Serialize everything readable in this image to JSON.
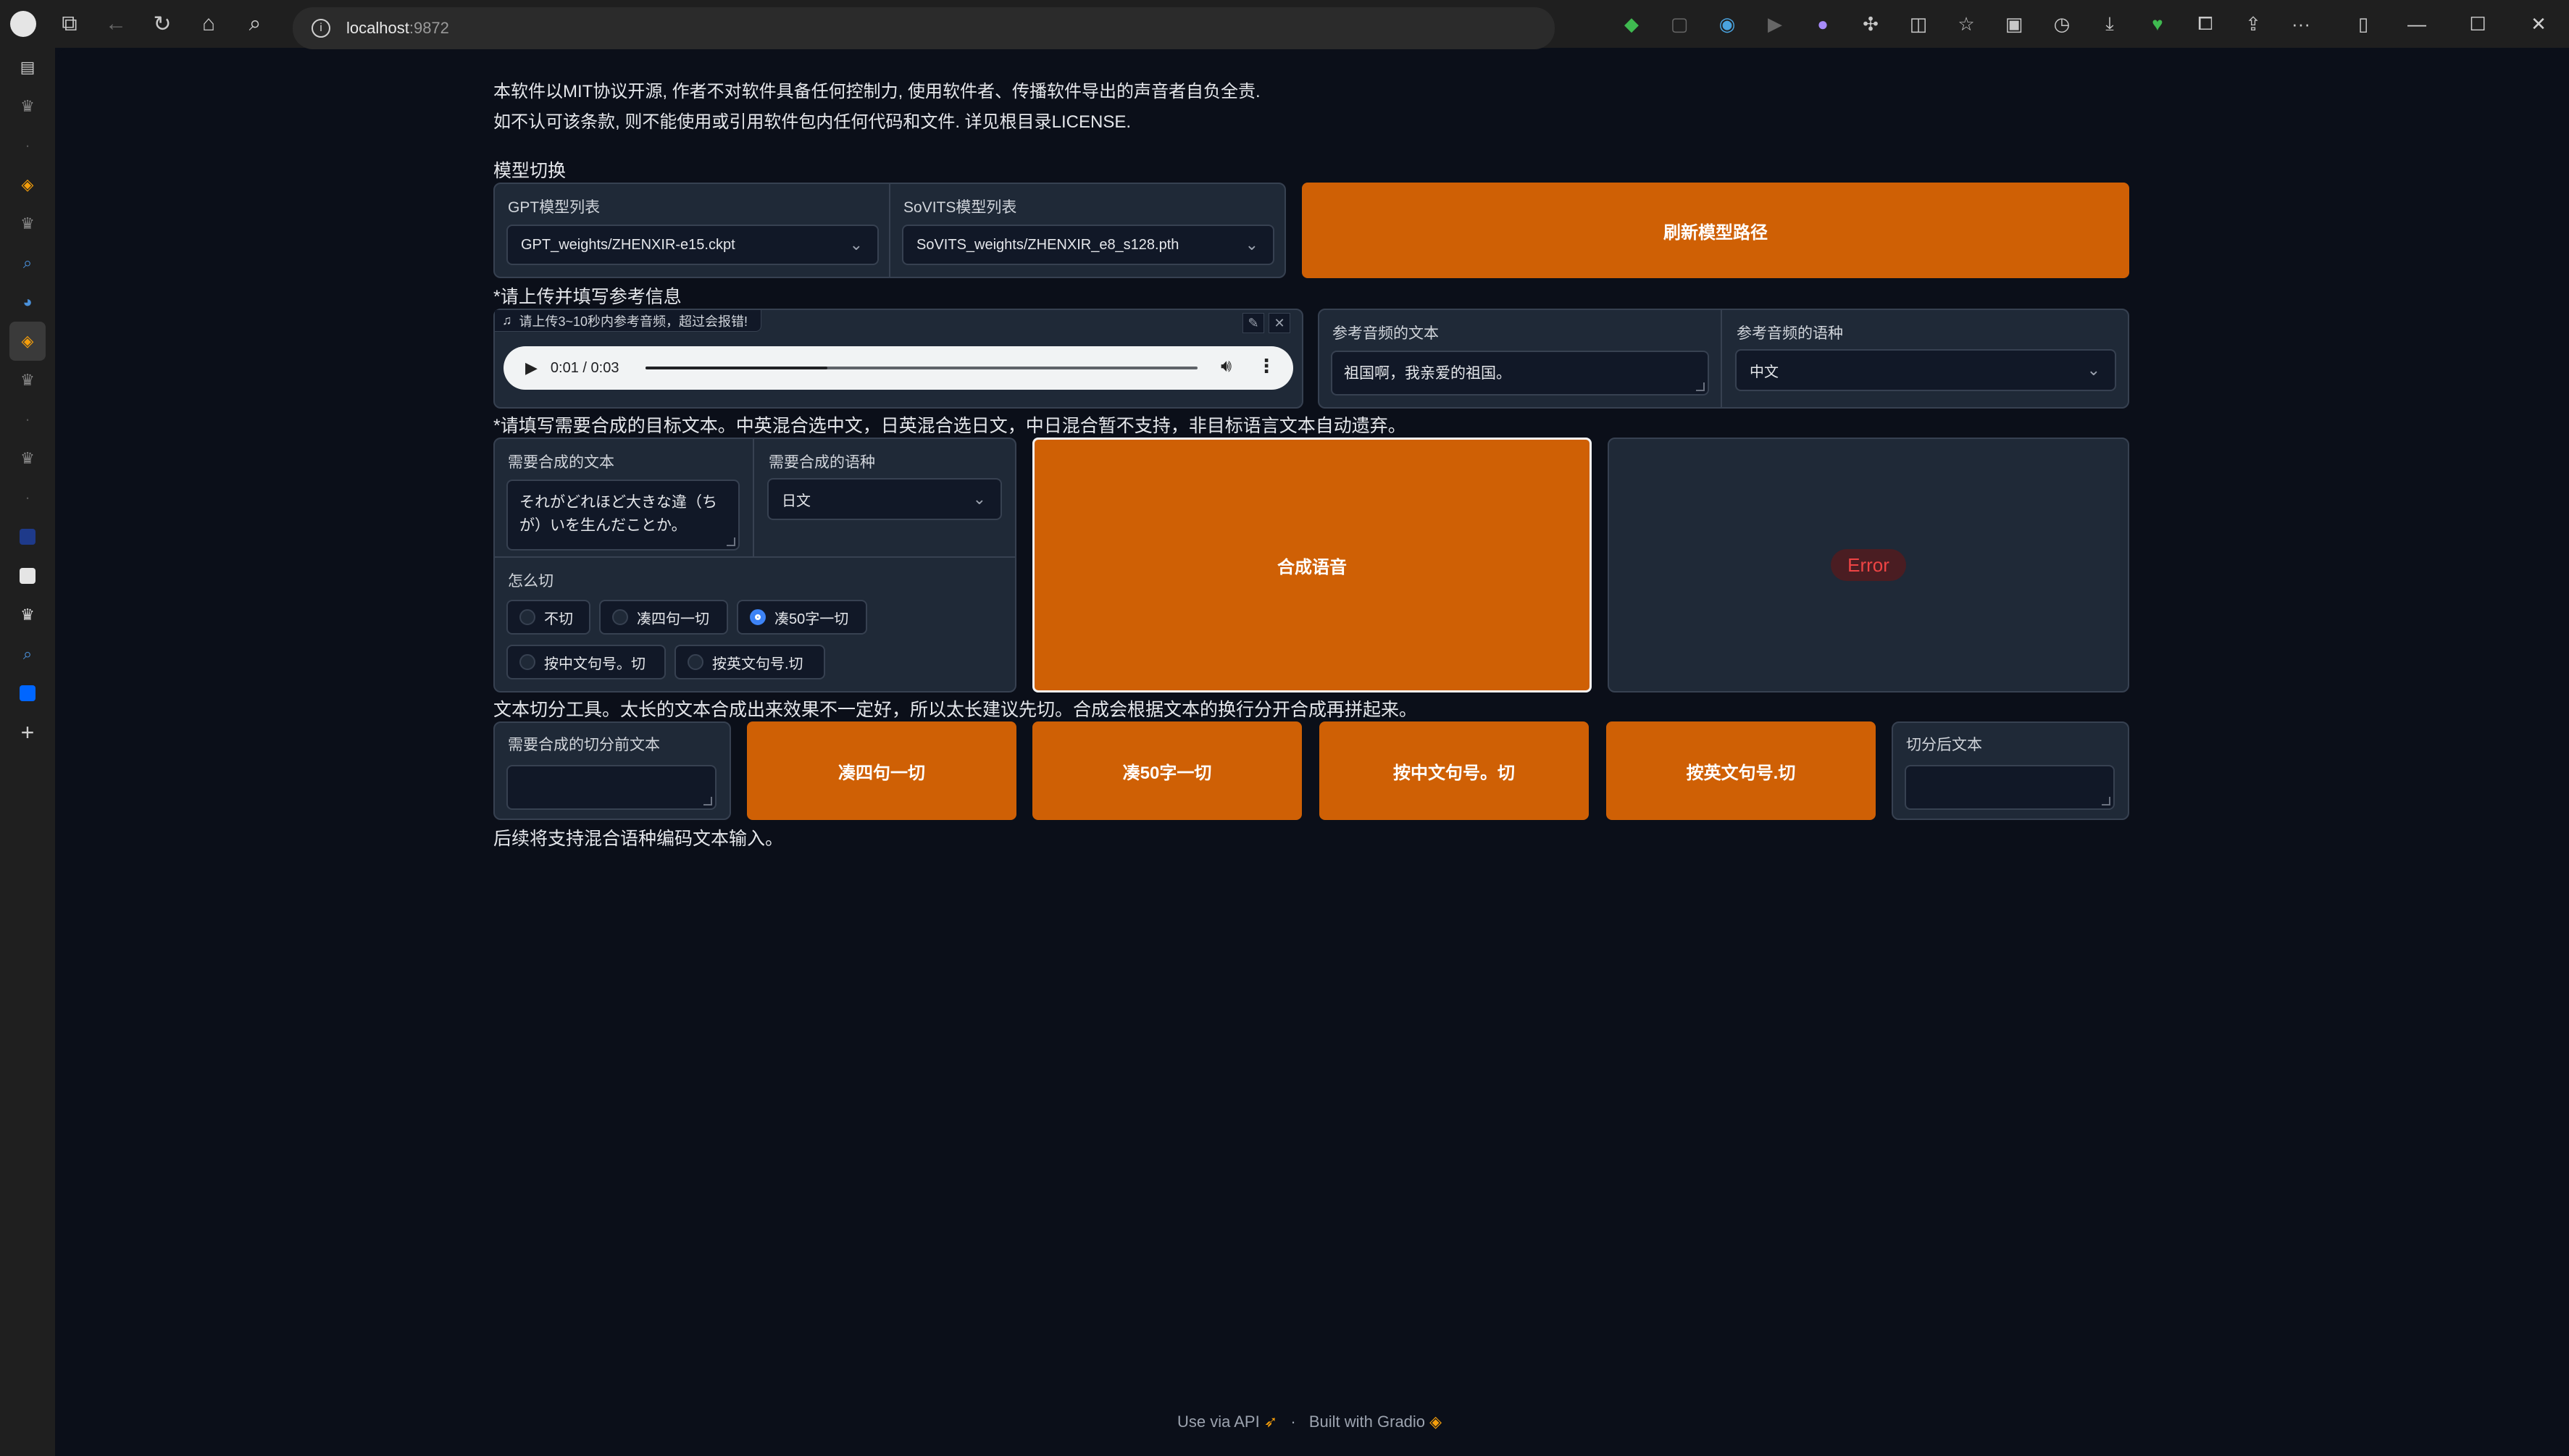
{
  "browser": {
    "url_host": "localhost",
    "url_port": ":9872"
  },
  "disclaimer": {
    "line1": "本软件以MIT协议开源, 作者不对软件具备任何控制力, 使用软件者、传播软件导出的声音者自负全责.",
    "line2": "如不认可该条款, 则不能使用或引用软件包内任何代码和文件. 详见根目录LICENSE."
  },
  "model_switch": {
    "section_label": "模型切换",
    "gpt_label": "GPT模型列表",
    "gpt_value": "GPT_weights/ZHENXIR-e15.ckpt",
    "sovits_label": "SoVITS模型列表",
    "sovits_value": "SoVITS_weights/ZHENXIR_e8_s128.pth",
    "refresh_button": "刷新模型路径"
  },
  "reference": {
    "section_label": "*请上传并填写参考信息",
    "audio_label": "请上传3~10秒内参考音频，超过会报错!",
    "audio_time": "0:01 / 0:03",
    "audio_progress": 0.33,
    "ref_text_label": "参考音频的文本",
    "ref_text_value": "祖国啊，我亲爱的祖国。",
    "ref_lang_label": "参考音频的语种",
    "ref_lang_value": "中文"
  },
  "synthesis": {
    "section_label": "*请填写需要合成的目标文本。中英混合选中文，日英混合选日文，中日混合暂不支持，非目标语言文本自动遗弃。",
    "target_text_label": "需要合成的文本",
    "target_text_value": "それがどれほど大きな違（ちが）いを生んだことか。",
    "target_lang_label": "需要合成的语种",
    "target_lang_value": "日文",
    "cut_label": "怎么切",
    "cut_options": [
      "不切",
      "凑四句一切",
      "凑50字一切",
      "按中文句号。切",
      "按英文句号.切"
    ],
    "cut_selected": "凑50字一切",
    "synth_button": "合成语音",
    "output_status": "Error"
  },
  "splitter": {
    "section_label": "文本切分工具。太长的文本合成出来效果不一定好，所以太长建议先切。合成会根据文本的换行分开合成再拼起来。",
    "input_label": "需要合成的切分前文本",
    "btn_four": "凑四句一切",
    "btn_fifty": "凑50字一切",
    "btn_cn": "按中文句号。切",
    "btn_en": "按英文句号.切",
    "output_label": "切分后文本"
  },
  "note": "后续将支持混合语种编码文本输入。",
  "footer": {
    "api": "Use via API",
    "sep": "·",
    "built": "Built with Gradio"
  }
}
